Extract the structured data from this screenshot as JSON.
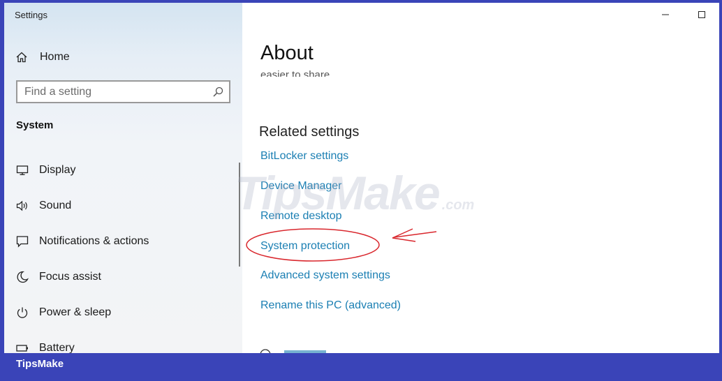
{
  "window": {
    "title": "Settings"
  },
  "sidebar": {
    "home_label": "Home",
    "search_placeholder": "Find a setting",
    "section_title": "System",
    "items": [
      {
        "label": "Display",
        "icon": "display-icon"
      },
      {
        "label": "Sound",
        "icon": "speaker-icon"
      },
      {
        "label": "Notifications & actions",
        "icon": "notification-icon"
      },
      {
        "label": "Focus assist",
        "icon": "moon-icon"
      },
      {
        "label": "Power & sleep",
        "icon": "power-icon"
      },
      {
        "label": "Battery",
        "icon": "battery-icon"
      }
    ]
  },
  "main": {
    "title": "About",
    "partial_text": "easier to share.",
    "related_title": "Related settings",
    "links": [
      "BitLocker settings",
      "Device Manager",
      "Remote desktop",
      "System protection",
      "Advanced system settings",
      "Rename this PC (advanced)"
    ]
  },
  "watermark": {
    "text": "TipsMake",
    "domain": ".com"
  },
  "footer": {
    "brand": "TipsMake"
  },
  "colors": {
    "link": "#1b7fb3",
    "frame": "#3a44b8",
    "annotation": "#d9262c"
  }
}
